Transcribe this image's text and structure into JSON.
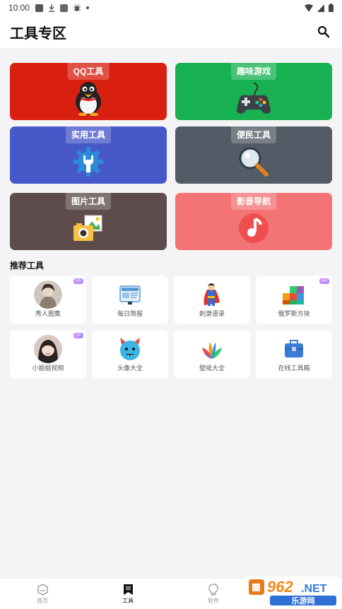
{
  "status_bar": {
    "time": "10:00"
  },
  "header": {
    "title": "工具专区"
  },
  "categories": [
    {
      "label": "QQ工具",
      "color": "#d81f10",
      "icon": "penguin-icon"
    },
    {
      "label": "趣味游戏",
      "color": "#18b151",
      "icon": "gamepad-icon"
    },
    {
      "label": "实用工具",
      "color": "#4758c9",
      "icon": "wrench-gear-icon"
    },
    {
      "label": "便民工具",
      "color": "#525b66",
      "icon": "magnifier-icon"
    },
    {
      "label": "图片工具",
      "color": "#5e4c4c",
      "icon": "picture-camera-icon"
    },
    {
      "label": "影音导航",
      "color": "#f47476",
      "icon": "music-note-icon"
    }
  ],
  "recommend": {
    "title": "推荐工具",
    "items": [
      {
        "name": "秀人图集",
        "vip": true,
        "icon": "girl-avatar-1"
      },
      {
        "name": "每日简报",
        "vip": false,
        "icon": "newspaper-icon"
      },
      {
        "name": "刺激语录",
        "vip": false,
        "icon": "superhero-icon"
      },
      {
        "name": "俄罗斯方块",
        "vip": true,
        "icon": "tetris-cubes-icon"
      },
      {
        "name": "小姐姐视频",
        "vip": true,
        "icon": "girl-avatar-2"
      },
      {
        "name": "头像大全",
        "vip": false,
        "icon": "devil-face-icon"
      },
      {
        "name": "壁纸大全",
        "vip": false,
        "icon": "leaves-icon"
      },
      {
        "name": "在线工具箱",
        "vip": false,
        "icon": "toolbox-icon"
      }
    ],
    "vip_text": "VIP"
  },
  "bottom_nav": [
    {
      "label": "首页",
      "icon": "home-hexagon-icon",
      "active": false
    },
    {
      "label": "工具",
      "icon": "bookmark-icon",
      "active": true
    },
    {
      "label": "软件",
      "icon": "lightbulb-icon",
      "active": false
    }
  ],
  "watermark": {
    "brand": "962.NET",
    "sub": "乐游网"
  }
}
